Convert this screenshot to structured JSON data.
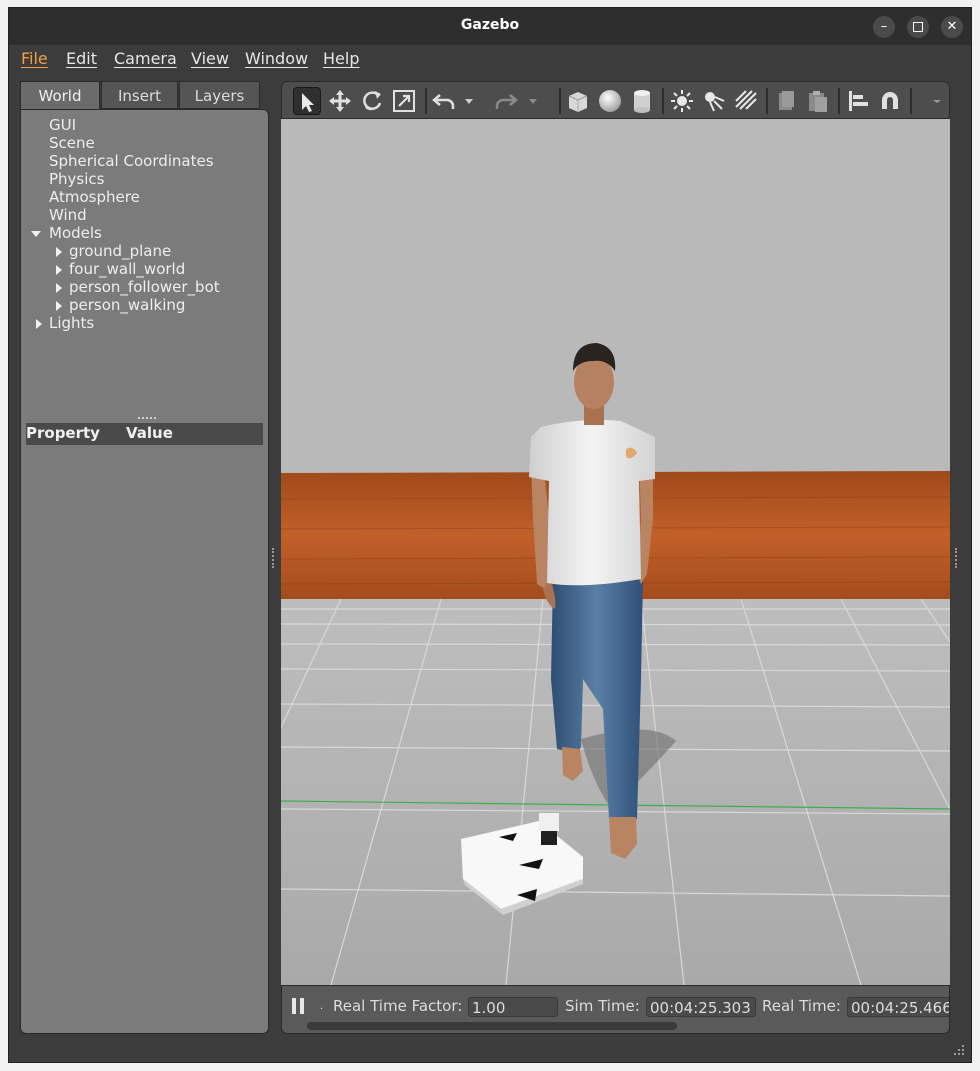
{
  "window": {
    "title": "Gazebo"
  },
  "menu": [
    "File",
    "Edit",
    "Camera",
    "View",
    "Window",
    "Help"
  ],
  "tabs": [
    "World",
    "Insert",
    "Layers"
  ],
  "tree": {
    "top": [
      "GUI",
      "Scene",
      "Spherical Coordinates",
      "Physics",
      "Atmosphere",
      "Wind"
    ],
    "models_label": "Models",
    "models": [
      "ground_plane",
      "four_wall_world",
      "person_follower_bot",
      "person_walking"
    ],
    "lights_label": "Lights"
  },
  "properties": {
    "col1": "Property",
    "col2": "Value"
  },
  "toolbar_icons": [
    "select-icon",
    "translate-icon",
    "rotate-icon",
    "scale-icon",
    "undo-icon",
    "redo-icon",
    "box-icon",
    "sphere-icon",
    "cylinder-icon",
    "point-light-icon",
    "spot-light-icon",
    "directional-light-icon",
    "copy-icon",
    "paste-icon",
    "align-icon",
    "snap-icon"
  ],
  "status": {
    "rtf_label": "Real Time Factor:",
    "rtf_value": "1.00",
    "sim_label": "Sim Time:",
    "sim_value": "00:04:25.303",
    "real_label": "Real Time:",
    "real_value": "00:04:25.466"
  },
  "colors": {
    "accent": "#f0a040",
    "wall": "#b0531d",
    "floor": "#b3b3b3",
    "sky": "#b9b9b9"
  }
}
